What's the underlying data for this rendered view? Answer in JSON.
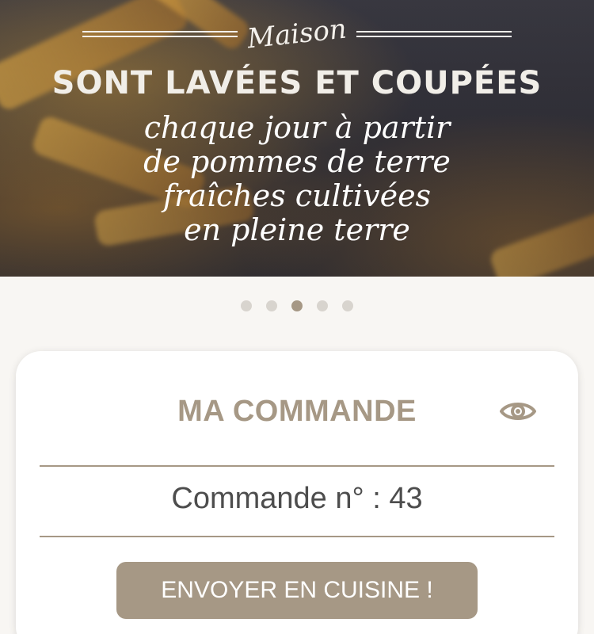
{
  "hero": {
    "maison": "Maison",
    "headline": "SONT LAVÉES ET COUPÉES",
    "lines": [
      "chaque jour à partir",
      "de pommes de terre",
      "fraîches cultivées",
      "en pleine terre"
    ]
  },
  "carousel": {
    "count": 5,
    "active_index": 2
  },
  "order": {
    "title": "MA COMMANDE",
    "number_text": "Commande n° : 43",
    "send_label": "ENVOYER EN CUISINE !",
    "view_icon": "eye-icon"
  },
  "colors": {
    "accent": "#a69885",
    "background": "#f8f6f3",
    "text_dark": "#4d4d4d",
    "dot_inactive": "#d8d4ce"
  }
}
